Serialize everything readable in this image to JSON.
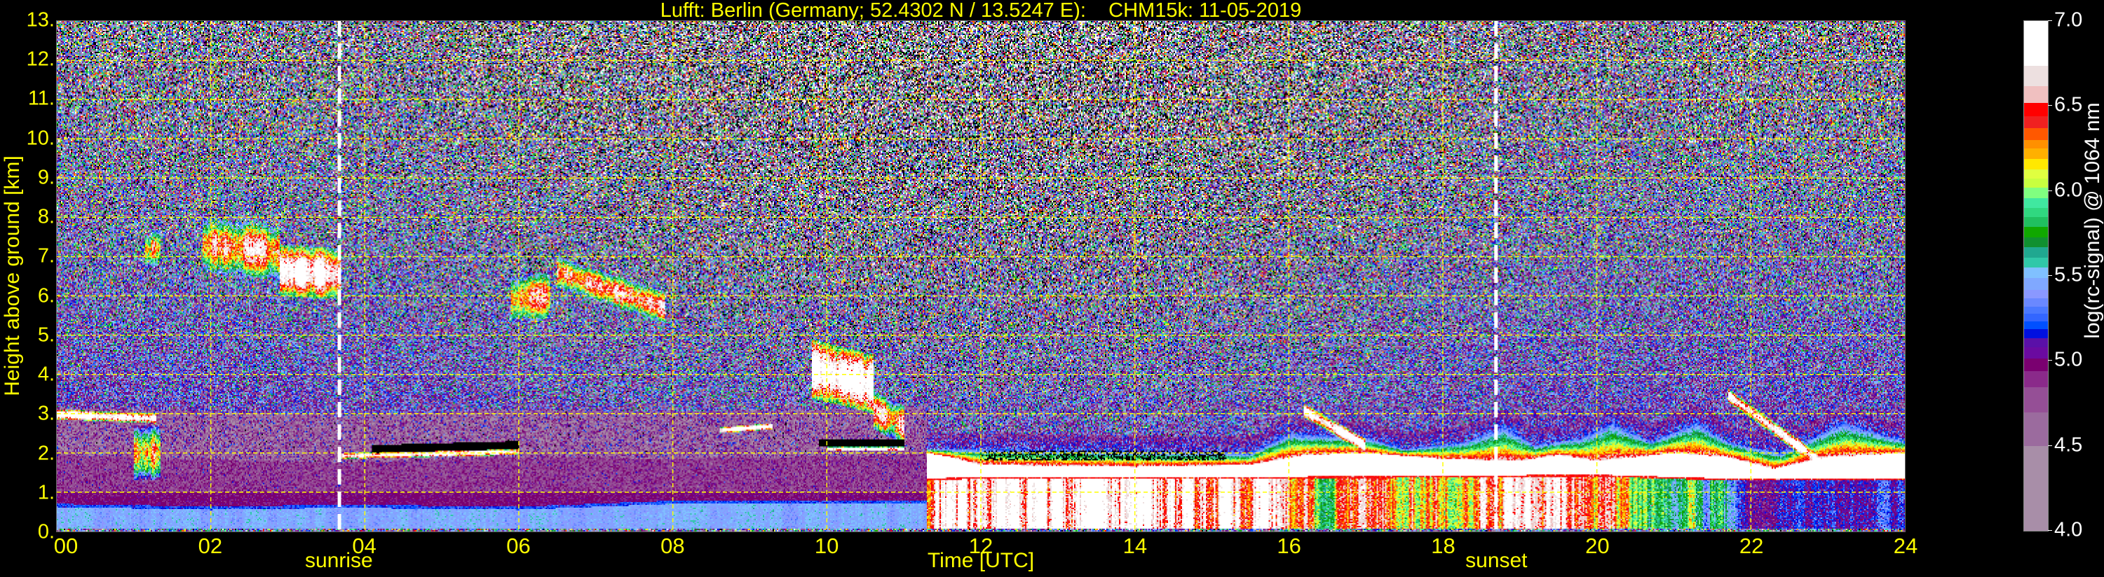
{
  "title": "Lufft: Berlin (Germany; 52.4302 N / 13.5247 E):    CHM15k: 11-05-2019",
  "chart_data": {
    "type": "heatmap",
    "title": "Lufft: Berlin (Germany; 52.4302 N / 13.5247 E):    CHM15k: 11-05-2019",
    "xlabel": "Time [UTC]",
    "ylabel": "Height above ground [km]",
    "xlim": [
      0,
      24
    ],
    "ylim": [
      0,
      13
    ],
    "xticks": [
      0,
      2,
      4,
      6,
      8,
      10,
      12,
      14,
      16,
      18,
      20,
      22,
      24
    ],
    "xtick_labels": [
      "00",
      "02",
      "04",
      "06",
      "08",
      "10",
      "12",
      "14",
      "16",
      "18",
      "20",
      "22",
      "24"
    ],
    "yticks": [
      0,
      1,
      2,
      3,
      4,
      5,
      6,
      7,
      8,
      9,
      10,
      11,
      12,
      13
    ],
    "ytick_labels": [
      "0.",
      "1.",
      "2.",
      "3.",
      "4.",
      "5.",
      "6.",
      "7.",
      "8.",
      "9.",
      "10.",
      "11.",
      "12.",
      "13."
    ],
    "grid": true,
    "grid_color": "#ffff00",
    "annotations": [
      {
        "label": "sunrise",
        "time_h": 3.67,
        "color": "#ffffff"
      },
      {
        "label": "sunset",
        "time_h": 18.69,
        "color": "#ffffff"
      }
    ],
    "colorbar": {
      "label": "log(rc-signal) @ 1064 nm",
      "range": [
        4.0,
        7.0
      ],
      "ticks": [
        4.0,
        4.5,
        5.0,
        5.5,
        6.0,
        6.5,
        7.0
      ],
      "tick_labels": [
        "4.0",
        "4.5",
        "5.0",
        "5.5",
        "6.0",
        "6.5",
        "7.0"
      ],
      "levels": [
        4.0,
        4.5,
        4.7,
        4.845,
        4.94,
        5.015,
        5.08,
        5.135,
        5.19,
        5.235,
        5.28,
        5.32,
        5.37,
        5.42,
        5.49,
        5.55,
        5.61,
        5.67,
        5.73,
        5.79,
        5.85,
        5.9,
        5.96,
        6.02,
        6.075,
        6.13,
        6.19,
        6.25,
        6.3,
        6.37,
        6.44,
        6.52,
        6.62,
        6.74,
        7.0
      ],
      "colors": [
        "#a88ea8",
        "#9b6b9e",
        "#954f96",
        "#8a2a8a",
        "#7a0070",
        "#6a0aa0",
        "#5a10a8",
        "#0010e0",
        "#0050ff",
        "#3366ff",
        "#4a78ff",
        "#6a88ff",
        "#8a98ff",
        "#80a8ff",
        "#80c0ff",
        "#30c8a8",
        "#20a890",
        "#109030",
        "#10a800",
        "#20c060",
        "#30d880",
        "#40e8a0",
        "#80ff80",
        "#c8ff40",
        "#e0ff40",
        "#ffe800",
        "#ffb000",
        "#ff9000",
        "#ff5800",
        "#f02020",
        "#ff0000",
        "#f0c0c0",
        "#ede0e0",
        "#ffffff"
      ]
    },
    "boundary_layer": {
      "aerosol_top_km": [
        [
          0,
          0.62
        ],
        [
          2,
          0.55
        ],
        [
          3.7,
          0.6
        ],
        [
          6,
          0.55
        ],
        [
          8,
          0.7
        ],
        [
          11.3,
          0.7
        ]
      ],
      "residual_top_km": [
        [
          0,
          1.95
        ],
        [
          3.7,
          1.75
        ],
        [
          6,
          1.9
        ],
        [
          8,
          1.85
        ],
        [
          11.3,
          1.95
        ]
      ],
      "mixed_layer_top_km": [
        [
          11.3,
          1.3
        ],
        [
          12,
          1.35
        ],
        [
          16,
          1.35
        ],
        [
          20,
          1.4
        ],
        [
          21.7,
          1.3
        ],
        [
          24,
          1.3
        ]
      ],
      "cloud_top_km": [
        [
          11.3,
          2.0
        ],
        [
          11.6,
          1.9
        ],
        [
          12,
          1.7
        ],
        [
          14,
          1.65
        ],
        [
          15.5,
          1.7
        ],
        [
          16.2,
          1.95
        ],
        [
          17,
          2.0
        ],
        [
          18,
          1.85
        ],
        [
          19,
          1.8
        ],
        [
          19.5,
          1.95
        ],
        [
          20,
          1.8
        ],
        [
          21,
          2.0
        ],
        [
          21.7,
          1.9
        ],
        [
          22.3,
          1.6
        ],
        [
          23,
          1.9
        ],
        [
          24,
          2.0
        ]
      ],
      "haze_top_km": [
        [
          11.3,
          2.1
        ],
        [
          12,
          2.1
        ],
        [
          15.5,
          2.0
        ],
        [
          16,
          2.5
        ],
        [
          17,
          2.4
        ],
        [
          17.5,
          2.1
        ],
        [
          18.3,
          2.3
        ],
        [
          18.8,
          2.7
        ],
        [
          19.2,
          2.2
        ],
        [
          19.8,
          2.4
        ],
        [
          20.2,
          2.8
        ],
        [
          20.7,
          2.3
        ],
        [
          21.3,
          2.8
        ],
        [
          21.7,
          2.3
        ],
        [
          22.4,
          2.0
        ],
        [
          23.2,
          2.8
        ],
        [
          24,
          2.3
        ]
      ],
      "mixed_layer_value": [
        [
          11.3,
          6.6
        ],
        [
          12,
          6.8
        ],
        [
          14,
          6.8
        ],
        [
          16,
          6.6
        ],
        [
          16.5,
          6.0
        ],
        [
          17,
          6.4
        ],
        [
          18,
          6.3
        ],
        [
          19,
          6.6
        ],
        [
          20,
          6.4
        ],
        [
          20.5,
          6.0
        ],
        [
          21,
          5.9
        ],
        [
          21.7,
          5.5
        ],
        [
          22,
          5.1
        ],
        [
          24,
          5.2
        ]
      ]
    },
    "clouds": [
      {
        "t0": 1.15,
        "t1": 1.35,
        "base0": 6.7,
        "base1": 6.8,
        "thick": 0.9,
        "value": 6.3
      },
      {
        "t0": 1.9,
        "t1": 2.9,
        "base0": 6.6,
        "base1": 6.4,
        "thick": 1.4,
        "value": 6.5
      },
      {
        "t0": 2.9,
        "t1": 3.7,
        "base0": 6.0,
        "base1": 5.9,
        "thick": 1.3,
        "value": 6.9
      },
      {
        "t0": 5.9,
        "t1": 6.4,
        "base0": 5.3,
        "base1": 5.4,
        "thick": 1.2,
        "value": 6.4
      },
      {
        "t0": 6.5,
        "t1": 7.9,
        "base0": 6.2,
        "base1": 5.3,
        "thick": 0.8,
        "value": 6.6
      },
      {
        "t0": 9.8,
        "t1": 10.6,
        "base0": 3.4,
        "base1": 3.0,
        "thick": 1.5,
        "value": 7.0
      },
      {
        "t0": 10.6,
        "t1": 11.0,
        "base0": 2.6,
        "base1": 2.2,
        "thick": 1.0,
        "value": 6.5
      },
      {
        "t0": 0.0,
        "t1": 1.3,
        "base0": 2.85,
        "base1": 2.75,
        "thick": 0.25,
        "value": 7.0
      },
      {
        "t0": 1.0,
        "t1": 1.35,
        "base0": 1.3,
        "base1": 1.3,
        "thick": 1.4,
        "value": 6.3
      },
      {
        "t0": 3.7,
        "t1": 6.0,
        "base0": 1.85,
        "base1": 1.95,
        "thick": 0.15,
        "value": 7.0
      },
      {
        "t0": 4.1,
        "t1": 6.0,
        "base0": 2.0,
        "base1": 2.1,
        "thick": 0.2,
        "gap": true
      },
      {
        "t0": 8.6,
        "t1": 9.3,
        "base0": 2.5,
        "base1": 2.6,
        "thick": 0.15,
        "value": 7.0
      },
      {
        "t0": 10.0,
        "t1": 11.0,
        "base0": 2.05,
        "base1": 2.05,
        "thick": 0.1,
        "value": 7.0
      },
      {
        "t0": 9.9,
        "t1": 11.0,
        "base0": 2.15,
        "base1": 2.15,
        "thick": 0.2,
        "gap": true
      },
      {
        "t0": 12.0,
        "t1": 15.2,
        "base0": 1.8,
        "base1": 1.8,
        "thick": 0.25,
        "gap": true,
        "p": 0.45
      },
      {
        "t0": 16.2,
        "t1": 17.0,
        "base0": 2.9,
        "base1": 2.0,
        "thick": 0.35,
        "value": 7.0
      },
      {
        "t0": 21.7,
        "t1": 22.9,
        "base0": 3.3,
        "base1": 1.6,
        "thick": 0.35,
        "value": 7.0
      }
    ]
  }
}
